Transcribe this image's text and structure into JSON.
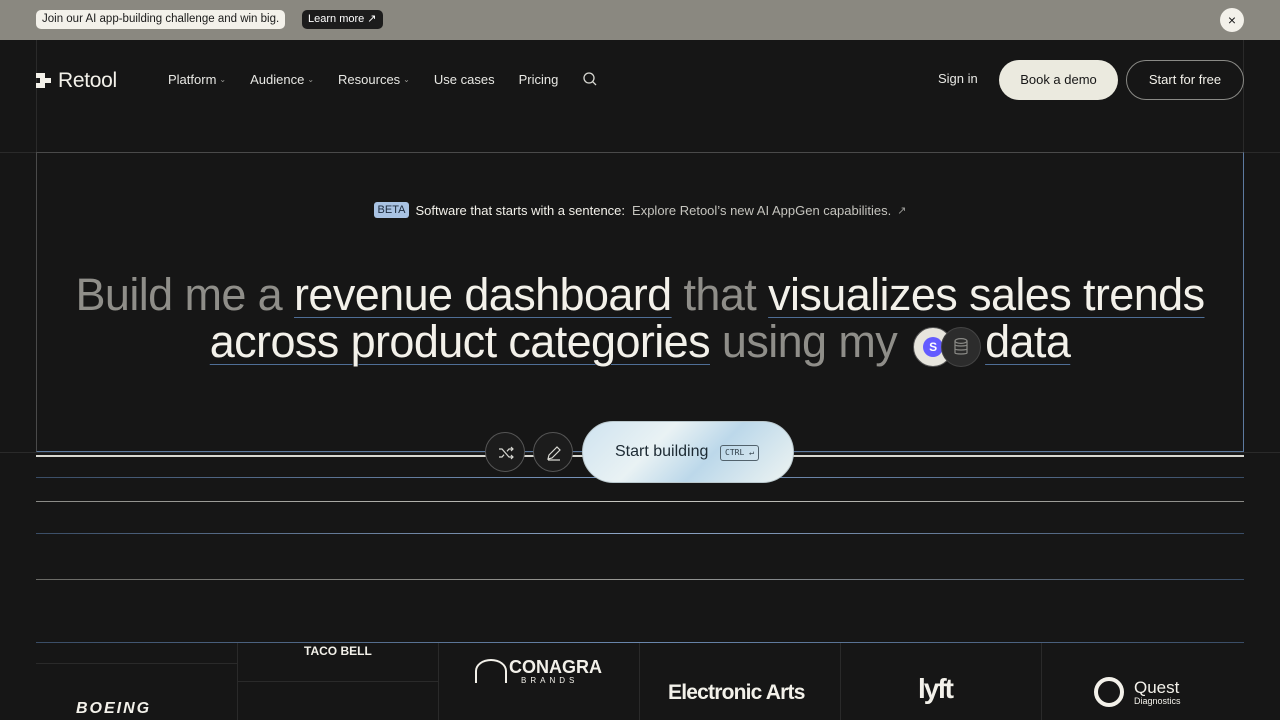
{
  "announcement": {
    "text": "Join our AI app-building challenge and win big.",
    "link_label": "Learn more ↗",
    "close_icon": "×"
  },
  "nav": {
    "brand": "Retool",
    "items": [
      {
        "label": "Platform",
        "has_dropdown": true
      },
      {
        "label": "Audience",
        "has_dropdown": true
      },
      {
        "label": "Resources",
        "has_dropdown": true
      },
      {
        "label": "Use cases",
        "has_dropdown": false
      },
      {
        "label": "Pricing",
        "has_dropdown": false
      }
    ],
    "signin_label": "Sign in",
    "demo_label": "Book a demo",
    "start_label": "Start for free"
  },
  "hero": {
    "badge": "BETA",
    "tagline": "Software that starts with a sentence:",
    "sub": "Explore Retool’s new AI AppGen capabilities.",
    "sub_arrow": "↗",
    "headline": {
      "p1": "Build me a ",
      "h1": "revenue dashboard",
      "p2": " that ",
      "h2": "visualizes sales trends",
      "h3": "across product categories",
      "p3": " using my ",
      "h4": "data"
    },
    "source_badge": "S"
  },
  "cta": {
    "build_label": "Start building",
    "shortcut": "CTRL ↵"
  },
  "logos": {
    "boeing": "BOEING",
    "tacobell": "TACO BELL",
    "conagra": "CONAGRA",
    "conagra_sub": "BRANDS",
    "ea": "Electronic Arts",
    "lyft": "lyft",
    "quest": "Quest",
    "quest_sub": "Diagnostics"
  },
  "colors": {
    "background": "#161616",
    "announcement": "#8a8880",
    "accent_blue": "#4f6e96",
    "cream": "#ebeadf"
  }
}
